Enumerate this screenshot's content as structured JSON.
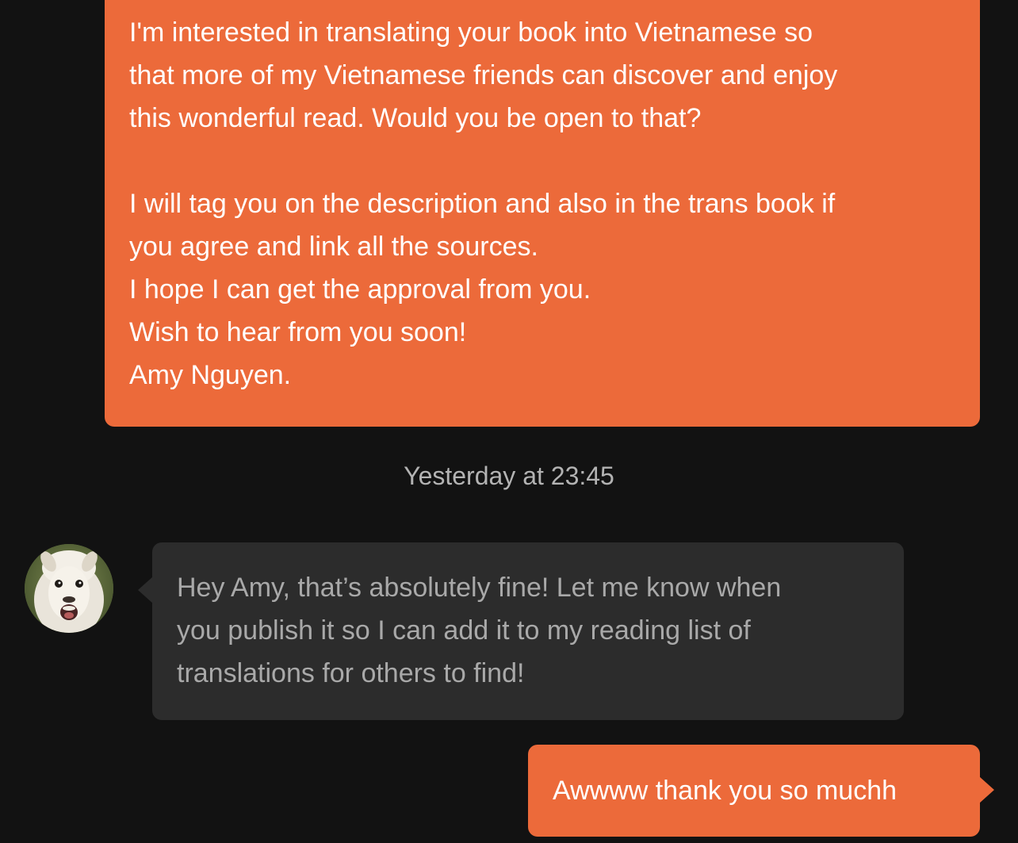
{
  "colors": {
    "background": "#121212",
    "outgoing_bubble": "#ec6a3a",
    "incoming_bubble": "#2c2c2c",
    "incoming_text": "#a9a9a9",
    "timestamp_text": "#b3b3b3"
  },
  "messages": [
    {
      "direction": "outgoing",
      "text": "I'm interested in translating your book into Vietnamese so\nthat more of my Vietnamese friends can discover and enjoy\nthis wonderful read. Would you be open to that?\n\nI will tag you on the description and also in the trans book if\nyou agree and link all the sources.\nI hope I can get the approval from you.\nWish to hear from you soon!\nAmy Nguyen."
    },
    {
      "direction": "incoming",
      "avatar": "alpaca-avatar",
      "text": "Hey Amy, that’s absolutely fine! Let me know when\nyou publish it so I can add it to my reading list of\ntranslations for others to find!"
    },
    {
      "direction": "outgoing",
      "text": "Awwww thank you so muchh"
    }
  ],
  "timestamp": "Yesterday at 23:45"
}
